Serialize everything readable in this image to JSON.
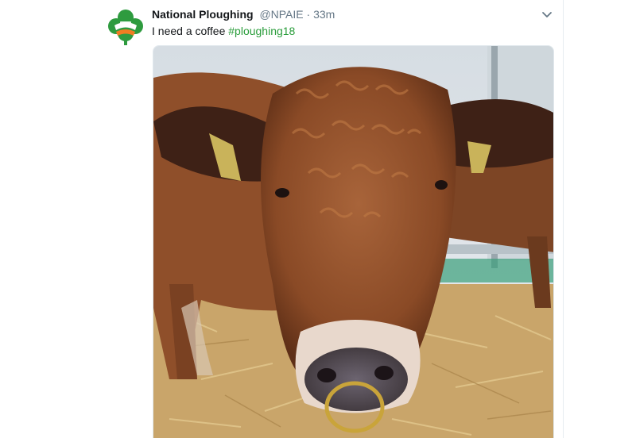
{
  "tweet": {
    "display_name": "National Ploughing",
    "handle": "@NPAIE",
    "separator": "·",
    "time": "33m",
    "text": "I need a coffee",
    "hashtag": "#ploughing18",
    "avatar_icon": "ploughing-shamrock-logo-icon",
    "menu_icon": "chevron-down-icon",
    "photo_subject": "bull-photo"
  },
  "colors": {
    "name": "#14171a",
    "muted": "#657786",
    "hashtag": "#2a9d3b",
    "logo_green": "#2e9b3f",
    "logo_orange": "#ef7d22"
  }
}
